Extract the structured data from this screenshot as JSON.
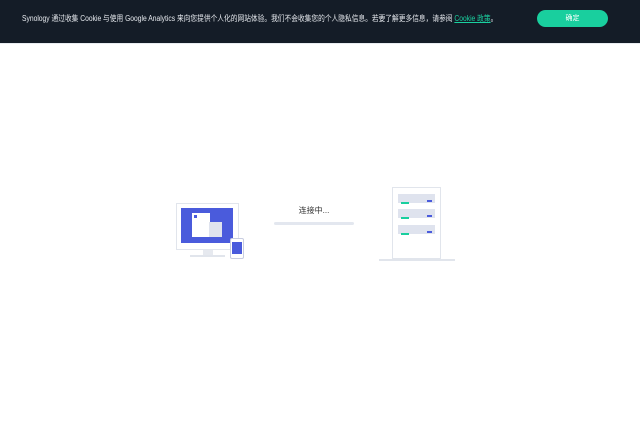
{
  "banner": {
    "text": "Synology 通过收集 Cookie 与使用 Google Analytics 来向您提供个人化的网站体验。我们不会收集您的个人隐私信息。若要了解更多信息，请参阅 ",
    "link": "Cookie 政策",
    "suffix": "。",
    "button": "确定"
  },
  "connection": {
    "status": "连接中...",
    "progress": 0
  },
  "colors": {
    "accent": "#19cf9e",
    "screen": "#4a5bdc",
    "banner_bg": "#141c27"
  }
}
